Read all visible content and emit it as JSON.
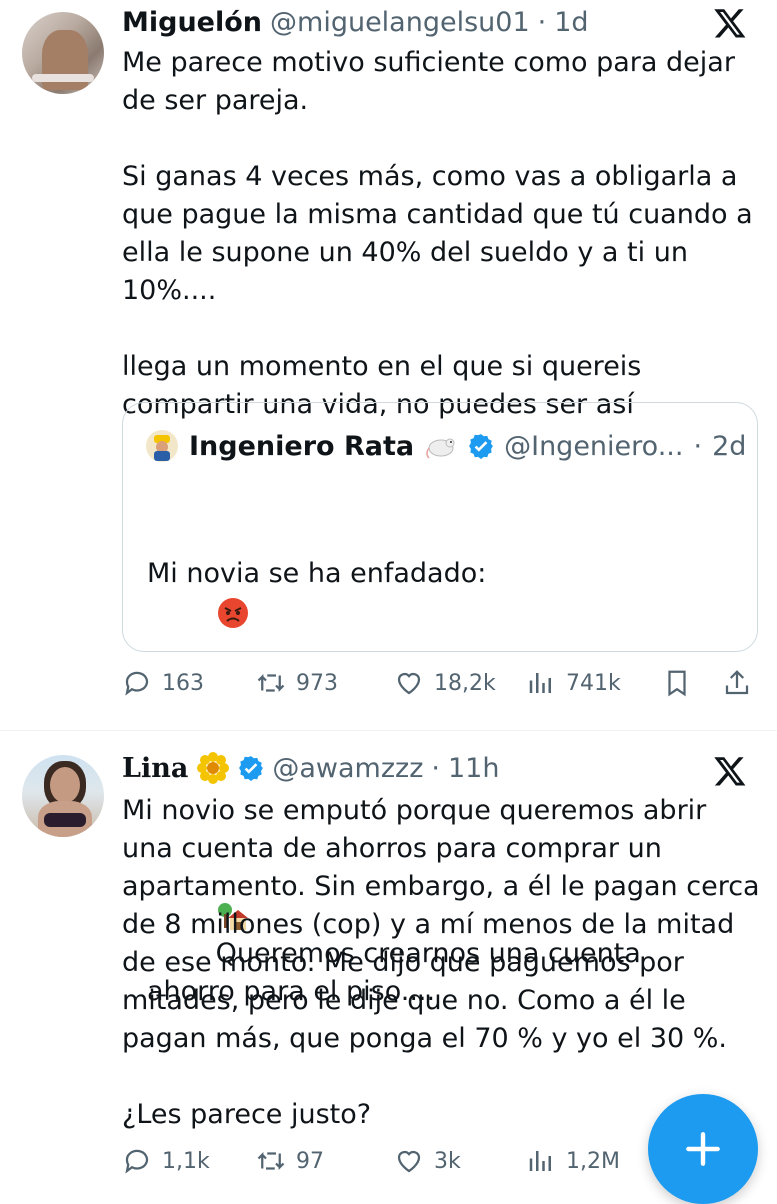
{
  "tweet1": {
    "name": "Miguelón",
    "handle": "@miguelangelsu01",
    "time": "1d",
    "text": "Me parece motivo suficiente como para dejar de ser pareja.\n\nSi ganas 4 veces más, como vas a obligarla a que pague la misma cantidad que tú cuando a ella le supone un 40% del sueldo y a ti un 10%....\n\nllega un momento en el que si quereis compartir una vida, no puedes ser así",
    "quote": {
      "name": "Ingeniero Rata",
      "handle": "@Ingeniero...",
      "time": "2d",
      "text_line1": "Mi novia se ha enfadado:",
      "text_line2": "Queremos crearnos una cuenta ahorro para el piso...."
    },
    "actions": {
      "replies": "163",
      "reposts": "973",
      "likes": "18,2k",
      "views": "741k"
    }
  },
  "tweet2": {
    "name": "Lina",
    "handle": "@awamzzz",
    "time": "11h",
    "text": "Mi novio se emputó porque queremos abrir una cuenta de ahorros para comprar un apartamento. Sin embargo, a él le pagan cerca de 8 millones (cop) y a mí menos de la mitad de ese monto. Me dijo que paguemos por mitades, pero le dije que no. Como a él le pagan más, que ponga el 70 % y yo el 30 %.\n\n¿Les parece justo?",
    "actions": {
      "replies": "1,1k",
      "reposts": "97",
      "likes": "3k",
      "views": "1,2M"
    }
  },
  "colors": {
    "accent": "#1d9bf0",
    "muted": "#536471",
    "text": "#0f1419",
    "border": "#cfd9de"
  },
  "icons": [
    "reply-icon",
    "repost-icon",
    "like-icon",
    "views-icon",
    "bookmark-icon",
    "share-icon",
    "x-logo-icon",
    "verified-icon",
    "compose-plus-icon"
  ]
}
